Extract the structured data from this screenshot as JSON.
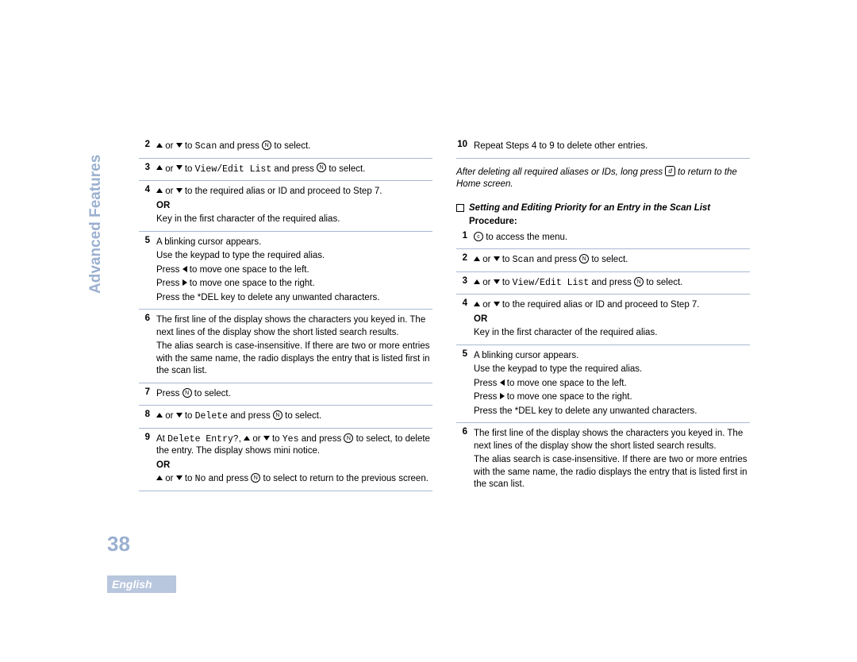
{
  "sidebar": {
    "label": "Advanced Features"
  },
  "page_number": "38",
  "language": "English",
  "glyphs": {
    "ok": "N",
    "menu": "c",
    "home": "d"
  },
  "text": {
    "to": " to ",
    "or_word": " or ",
    "and_press": " and press ",
    "to_select": " to select.",
    "scan": "Scan",
    "view_edit": "View/Edit List",
    "delete": "Delete",
    "delete_entry": "Delete Entry?",
    "yes": "Yes",
    "no": "No",
    "OR": "OR",
    "step4_line": " to the required alias or ID and proceed to Step 7.",
    "step4_keyin": "Key in the first character of the required alias.",
    "step5_l1": "A blinking cursor appears.",
    "step5_l2": "Use the keypad to type the required alias.",
    "step5_l3a": "Press ",
    "step5_l3b": " to move one space to the left.",
    "step5_l4b": " to move one space to the right.",
    "step5_l5": "Press the *DEL key to delete any unwanted characters.",
    "step6_l1": "The first line of the display shows the characters you keyed in. The next lines of the display show the short listed search results.",
    "step6_l2": "The alias search is case-insensitive. If there are two or more entries with the same name, the radio displays the entry that is listed first in the scan list.",
    "step7": "Press ",
    "step9_at": "At ",
    "step9_mid": ", ",
    "step9_tail": " to select, to delete the entry. The display shows mini notice.",
    "step9_back": " to select to return to the previous screen.",
    "step10": "Repeat Steps 4 to 9 to delete other entries.",
    "after_delete": "After deleting all required aliases or IDs, long press ",
    "after_delete_tail": " to return to the Home screen.",
    "section_title": "Setting and Editing Priority for an Entry in the Scan List",
    "procedure": "Procedure:",
    "r_step1": " to access the menu."
  }
}
